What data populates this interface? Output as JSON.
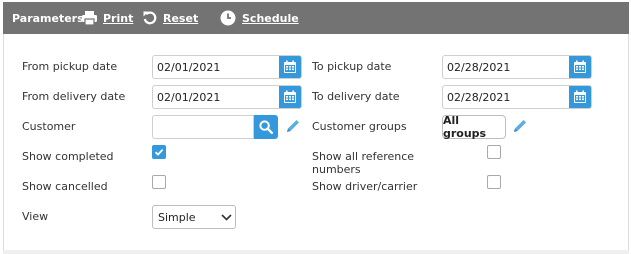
{
  "toolbar": {
    "title": "Parameters",
    "print_label": "Print",
    "reset_label": "Reset",
    "schedule_label": "Schedule"
  },
  "form": {
    "from_pickup": {
      "label": "From pickup date",
      "value": "02/01/2021"
    },
    "to_pickup": {
      "label": "To pickup date",
      "value": "02/28/2021"
    },
    "from_delivery": {
      "label": "From delivery date",
      "value": "02/01/2021"
    },
    "to_delivery": {
      "label": "To delivery date",
      "value": "02/28/2021"
    },
    "customer": {
      "label": "Customer",
      "value": ""
    },
    "customer_groups": {
      "label": "Customer groups",
      "button_label": "All groups"
    },
    "show_completed": {
      "label": "Show completed",
      "checked": true
    },
    "show_all_reference": {
      "label_line1": "Show all reference",
      "label_line2": "numbers",
      "checked": false
    },
    "show_cancelled": {
      "label": "Show cancelled",
      "checked": false
    },
    "show_driver_carrier": {
      "label": "Show driver/carrier",
      "checked": false
    },
    "view": {
      "label": "View",
      "selected": "Simple"
    }
  },
  "icons": {
    "print": "printer-icon",
    "reset": "reset-icon",
    "schedule": "clock-icon",
    "calendar": "calendar-icon",
    "search": "search-icon",
    "edit": "pencil-icon",
    "dropdown": "chevron-down-icon",
    "check": "checkmark-icon"
  },
  "colors": {
    "toolbar_bg": "#737373",
    "accent": "#3498db"
  }
}
